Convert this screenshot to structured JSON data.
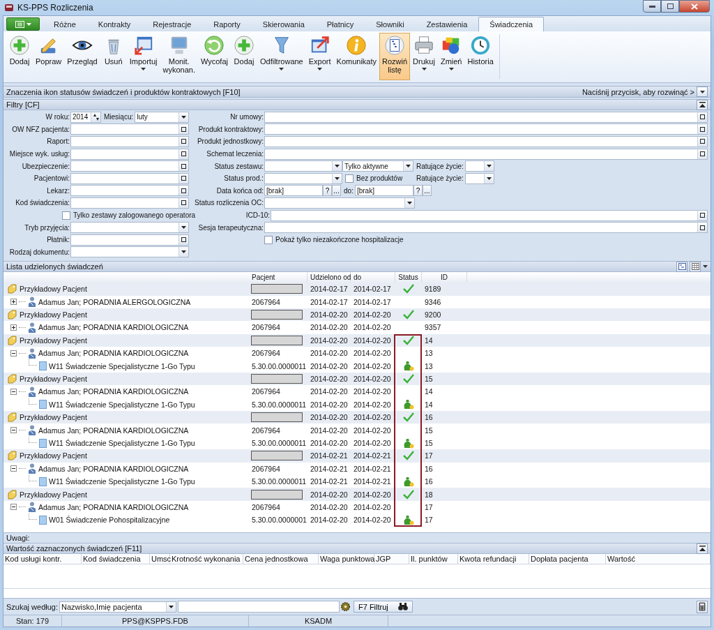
{
  "window": {
    "title": "KS-PPS Rozliczenia"
  },
  "tabs": [
    {
      "label": "Różne",
      "selected": false
    },
    {
      "label": "Kontrakty",
      "selected": false
    },
    {
      "label": "Rejestracje",
      "selected": false
    },
    {
      "label": "Raporty",
      "selected": false
    },
    {
      "label": "Skierowania",
      "selected": false
    },
    {
      "label": "Płatnicy",
      "selected": false
    },
    {
      "label": "Słowniki",
      "selected": false
    },
    {
      "label": "Zestawienia",
      "selected": false
    },
    {
      "label": "Świadczenia",
      "selected": true
    }
  ],
  "ribbon": [
    {
      "label": "Dodaj",
      "kind": "add",
      "dropdown": false,
      "selected": false
    },
    {
      "label": "Popraw",
      "kind": "edit",
      "dropdown": false,
      "selected": false
    },
    {
      "label": "Przegląd",
      "kind": "view",
      "dropdown": false,
      "selected": false
    },
    {
      "label": "Usuń",
      "kind": "delete",
      "dropdown": false,
      "selected": false
    },
    {
      "label": "Importuj",
      "kind": "import",
      "dropdown": true,
      "selected": false
    },
    {
      "label": "Monit.\nwykonan.",
      "kind": "monitor",
      "dropdown": false,
      "selected": false
    },
    {
      "label": "Wycofaj",
      "kind": "undo",
      "dropdown": false,
      "selected": false
    },
    {
      "label": "Dodaj",
      "kind": "add",
      "dropdown": false,
      "selected": false
    },
    {
      "label": "Odfiltrowane",
      "kind": "filter",
      "dropdown": true,
      "selected": false
    },
    {
      "label": "Export",
      "kind": "export",
      "dropdown": true,
      "selected": false
    },
    {
      "label": "Komunikaty",
      "kind": "info",
      "dropdown": false,
      "selected": false
    },
    {
      "label": "Rozwiń\nlistę",
      "kind": "expand",
      "dropdown": false,
      "selected": true
    },
    {
      "label": "Drukuj",
      "kind": "print",
      "dropdown": true,
      "selected": false
    },
    {
      "label": "Zmień",
      "kind": "change",
      "dropdown": true,
      "selected": false
    },
    {
      "label": "Historia",
      "kind": "history",
      "dropdown": false,
      "selected": false
    }
  ],
  "info_bar": {
    "title": "Znaczenia ikon statusów świadczeń i produktów kontraktowych [F10]",
    "hint": "Naciśnij przycisk, aby rozwinąć >"
  },
  "filters": {
    "title": "Filtry [CF]",
    "rows": [
      {
        "left": [
          {
            "kind": "spin",
            "label": "W roku:",
            "value": "2014"
          },
          {
            "kind": "dropdown",
            "label": "Miesiącu:",
            "value": "luty"
          }
        ],
        "right": [
          {
            "kind": "picker",
            "label": "Nr umowy:"
          }
        ]
      },
      {
        "left": [
          {
            "kind": "picker",
            "label": "OW NFZ pacjenta:"
          }
        ],
        "right": [
          {
            "kind": "picker",
            "label": "Produkt kontraktowy:"
          }
        ]
      },
      {
        "left": [
          {
            "kind": "picker",
            "label": "Raport:"
          }
        ],
        "right": [
          {
            "kind": "picker",
            "label": "Produkt jednostkowy:"
          }
        ]
      },
      {
        "left": [
          {
            "kind": "picker",
            "label": "Miejsce wyk. usług:"
          }
        ],
        "right": [
          {
            "kind": "picker",
            "label": "Schemat leczenia:"
          }
        ]
      },
      {
        "left": [
          {
            "kind": "picker",
            "label": "Ubezpieczenie:"
          }
        ],
        "right": [
          {
            "kind": "dropdown",
            "label": "Status zestawu:"
          },
          {
            "kind": "dropdown",
            "value": "Tylko aktywne"
          },
          {
            "kind": "dropdown",
            "label": "Ratujące życie:"
          }
        ]
      },
      {
        "left": [
          {
            "kind": "picker",
            "label": "Pacjentowi:"
          }
        ],
        "right": [
          {
            "kind": "dropdown",
            "label": "Status prod.:"
          },
          {
            "kind": "checkbox",
            "label": "Bez produktów",
            "checked": false
          },
          {
            "kind": "dropdown",
            "label": "Ratujące życie:"
          }
        ]
      },
      {
        "left": [
          {
            "kind": "picker",
            "label": "Lekarz:"
          }
        ],
        "right": [
          {
            "kind": "date",
            "label": "Data końca od:",
            "value": "[brak]",
            "buttons": [
              "?",
              "..."
            ]
          },
          {
            "kind": "date",
            "label": "do:",
            "value": "[brak]",
            "buttons": [
              "?",
              "..."
            ]
          }
        ]
      },
      {
        "left": [
          {
            "kind": "picker",
            "label": "Kod świadczenia:"
          }
        ],
        "right": [
          {
            "kind": "dropdown",
            "label": "Status rozliczenia OC:"
          }
        ]
      },
      {
        "left": [
          {
            "kind": "checkbox",
            "label": "Tylko zestawy zalogowanego operatora",
            "checked": false
          }
        ],
        "right": [
          {
            "kind": "picker",
            "label": "ICD-10:"
          }
        ]
      },
      {
        "left": [
          {
            "kind": "dropdown",
            "label": "Tryb przyjęcia:"
          }
        ],
        "right": [
          {
            "kind": "picker",
            "label": "Sesja terapeutyczna:"
          }
        ]
      },
      {
        "left": [
          {
            "kind": "picker",
            "label": "Płatnik:"
          }
        ],
        "right": [
          {
            "kind": "checkbox",
            "label": "Pokaż tylko niezakończone hospitalizacje",
            "checked": false
          }
        ]
      },
      {
        "left": [
          {
            "kind": "dropdown",
            "label": "Rodzaj dokumentu:"
          }
        ],
        "right": []
      }
    ]
  },
  "list": {
    "title": "Lista udzielonych świadczeń",
    "columns": [
      "Pacjent",
      "Udzielono od",
      "do",
      "Status",
      "ID"
    ],
    "rows": [
      {
        "kind": "patient",
        "name": "Przykładowy Pacjent",
        "from": "2014-02-17",
        "to": "2014-02-17",
        "confirmed": true,
        "id": "9189",
        "highlighted": false,
        "children": [
          {
            "kind": "visit",
            "name": "Adamus Jan; PORADNIA ALERGOLOGICZNA",
            "pacjent": "2067964",
            "from": "2014-02-17",
            "to": "2014-02-17",
            "id": "9346",
            "expanded": false
          }
        ]
      },
      {
        "kind": "patient",
        "name": "Przykładowy Pacjent",
        "from": "2014-02-20",
        "to": "2014-02-20",
        "confirmed": true,
        "id": "9200",
        "highlighted": false,
        "children": [
          {
            "kind": "visit",
            "name": "Adamus Jan; PORADNIA KARDIOLOGICZNA",
            "pacjent": "2067964",
            "from": "2014-02-20",
            "to": "2014-02-20",
            "id": "9357",
            "expanded": false
          }
        ]
      },
      {
        "kind": "patient",
        "name": "Przykładowy Pacjent",
        "from": "2014-02-20",
        "to": "2014-02-20",
        "confirmed": true,
        "id": "14",
        "highlighted": true,
        "children": [
          {
            "kind": "visit",
            "name": "Adamus Jan; PORADNIA KARDIOLOGICZNA",
            "pacjent": "2067964",
            "from": "2014-02-20",
            "to": "2014-02-20",
            "id": "13",
            "expanded": true,
            "children": [
              {
                "kind": "service",
                "name": "W11 Świadczenie Specjalistyczne 1-Go Typu",
                "pacjent": "5.30.00.0000011",
                "from": "2014-02-20",
                "to": "2014-02-20",
                "billed": true,
                "id": "13"
              }
            ]
          }
        ]
      },
      {
        "kind": "patient",
        "name": "Przykładowy Pacjent",
        "from": "2014-02-20",
        "to": "2014-02-20",
        "confirmed": true,
        "id": "15",
        "highlighted": true,
        "children": [
          {
            "kind": "visit",
            "name": "Adamus Jan; PORADNIA KARDIOLOGICZNA",
            "pacjent": "2067964",
            "from": "2014-02-20",
            "to": "2014-02-20",
            "id": "14",
            "expanded": true,
            "children": [
              {
                "kind": "service",
                "name": "W11 Świadczenie Specjalistyczne 1-Go Typu",
                "pacjent": "5.30.00.0000011",
                "from": "2014-02-20",
                "to": "2014-02-20",
                "billed": true,
                "id": "14"
              }
            ]
          }
        ]
      },
      {
        "kind": "patient",
        "name": "Przykładowy Pacjent",
        "from": "2014-02-20",
        "to": "2014-02-20",
        "confirmed": true,
        "id": "16",
        "highlighted": true,
        "children": [
          {
            "kind": "visit",
            "name": "Adamus Jan; PORADNIA KARDIOLOGICZNA",
            "pacjent": "2067964",
            "from": "2014-02-20",
            "to": "2014-02-20",
            "id": "15",
            "expanded": true,
            "children": [
              {
                "kind": "service",
                "name": "W11 Świadczenie Specjalistyczne 1-Go Typu",
                "pacjent": "5.30.00.0000011",
                "from": "2014-02-20",
                "to": "2014-02-20",
                "billed": true,
                "id": "15"
              }
            ]
          }
        ]
      },
      {
        "kind": "patient",
        "name": "Przykładowy Pacjent",
        "from": "2014-02-21",
        "to": "2014-02-21",
        "confirmed": true,
        "id": "17",
        "highlighted": true,
        "children": [
          {
            "kind": "visit",
            "name": "Adamus Jan; PORADNIA KARDIOLOGICZNA",
            "pacjent": "2067964",
            "from": "2014-02-21",
            "to": "2014-02-21",
            "id": "16",
            "expanded": true,
            "children": [
              {
                "kind": "service",
                "name": "W11 Świadczenie Specjalistyczne 1-Go Typu",
                "pacjent": "5.30.00.0000011",
                "from": "2014-02-21",
                "to": "2014-02-21",
                "billed": true,
                "id": "16"
              }
            ]
          }
        ]
      },
      {
        "kind": "patient",
        "name": "Przykładowy Pacjent",
        "from": "2014-02-20",
        "to": "2014-02-20",
        "confirmed": true,
        "id": "18",
        "highlighted": true,
        "children": [
          {
            "kind": "visit",
            "name": "Adamus Jan; PORADNIA KARDIOLOGICZNA",
            "pacjent": "2067964",
            "from": "2014-02-20",
            "to": "2014-02-20",
            "id": "17",
            "expanded": true,
            "children": [
              {
                "kind": "service",
                "name": "W01 Świadczenie Pohospitalizacyjne",
                "pacjent": "5.30.00.0000001",
                "from": "2014-02-20",
                "to": "2014-02-20",
                "billed": true,
                "id": "17"
              }
            ]
          }
        ]
      }
    ]
  },
  "notes_label": "Uwagi:",
  "values_panel": {
    "title": "Wartość zaznaczonych świadczeń [F11]",
    "columns": [
      "Kod usługi kontr.",
      "Kod świadczenia",
      "Umsc",
      "Krotność wykonania",
      "Cena jednostkowa",
      "Waga punktowa",
      "JGP",
      "Il. punktów",
      "Kwota refundacji",
      "Dopłata pacjenta",
      "Wartość"
    ]
  },
  "search": {
    "label": "Szukaj według:",
    "field": "Nazwisko,Imię pacjenta",
    "button": "F7 Filtruj"
  },
  "status_bar": [
    "Stan: 179",
    "PPS@KSPPS.FDB",
    "KSADM"
  ]
}
